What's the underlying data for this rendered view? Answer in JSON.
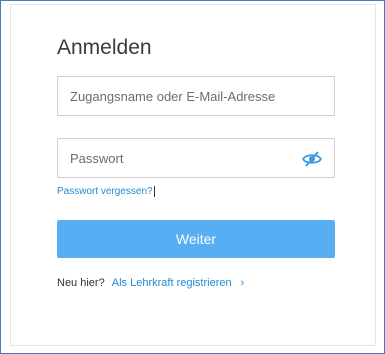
{
  "login": {
    "title": "Anmelden",
    "username_placeholder": "Zugangsname oder E-Mail-Adresse",
    "username_value": "",
    "password_placeholder": "Passwort",
    "password_value": "",
    "forgot_link": "Passwort vergessen?",
    "submit_label": "Weiter",
    "signup_prompt": "Neu hier?",
    "signup_link": "Als Lehrkraft registrieren",
    "signup_chevron": "›"
  },
  "icons": {
    "password_toggle": "eye-slash-icon"
  },
  "colors": {
    "primary_button": "#58aef3",
    "link": "#1e8ad6",
    "frame_border": "#4a78c2"
  }
}
